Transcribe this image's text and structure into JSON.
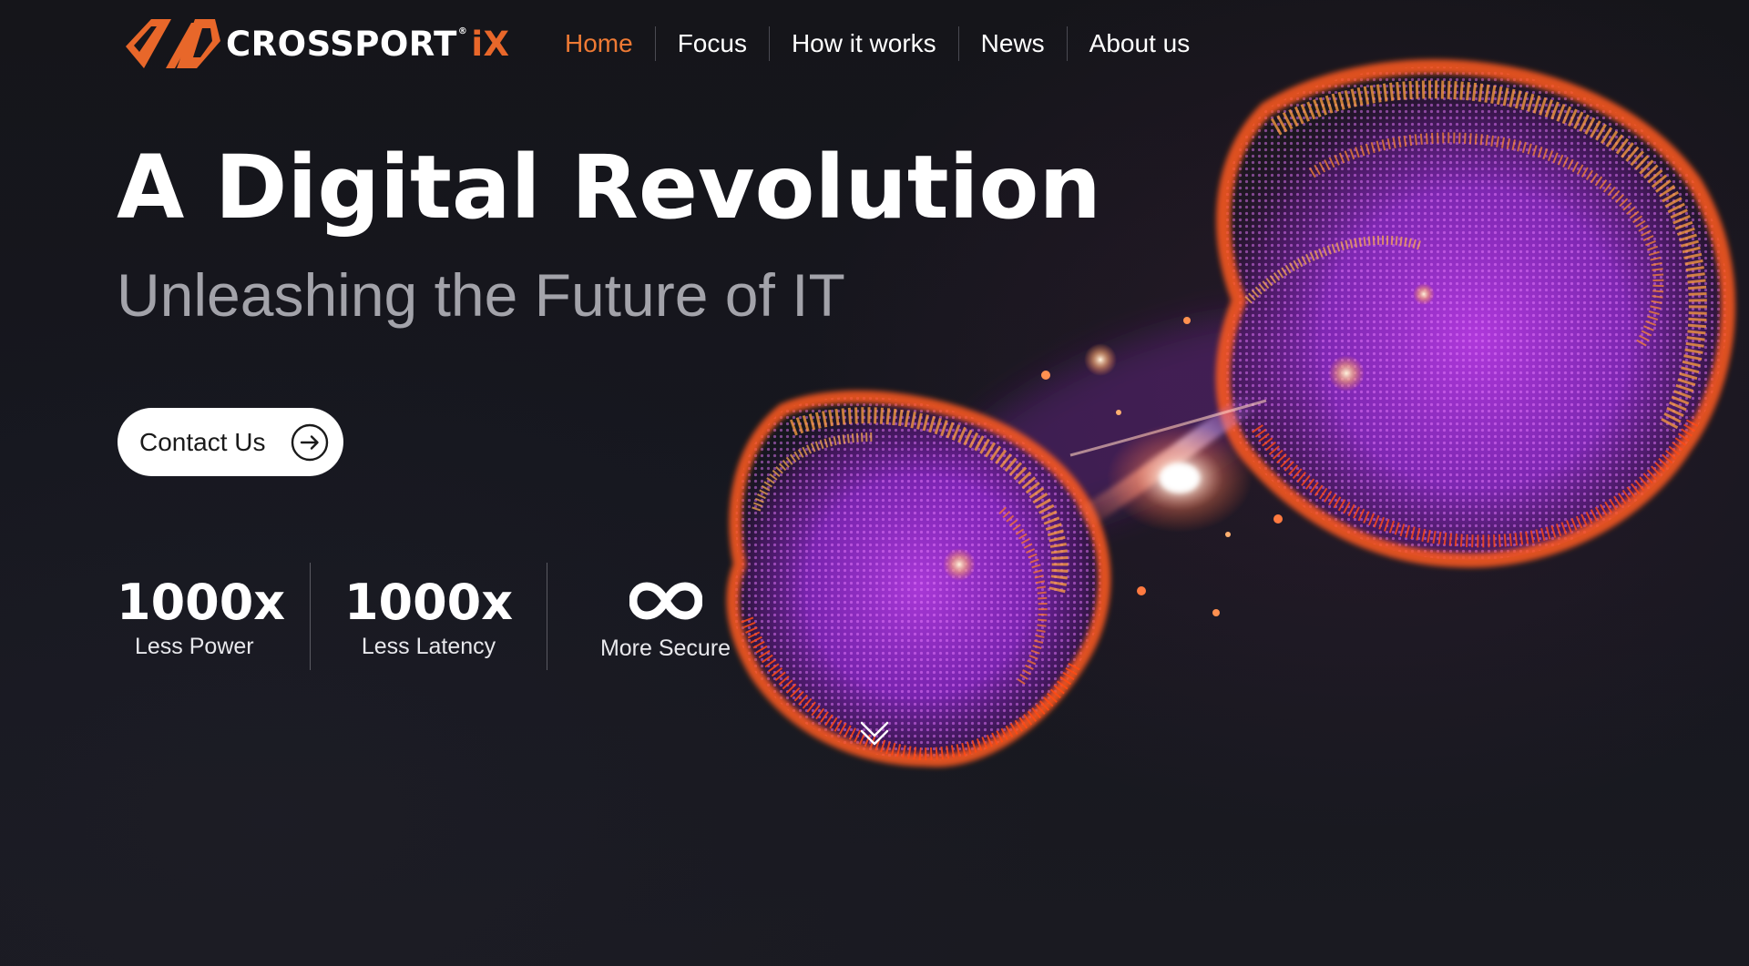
{
  "brand": {
    "name": "CROSSPORT",
    "suffix": "iX",
    "registered_mark": "®",
    "accent_color": "#e8672a"
  },
  "nav": {
    "items": [
      {
        "label": "Home",
        "active": true
      },
      {
        "label": "Focus",
        "active": false
      },
      {
        "label": "How it works",
        "active": false
      },
      {
        "label": "News",
        "active": false
      },
      {
        "label": "About us",
        "active": false
      }
    ],
    "active_color": "#ee7a34"
  },
  "hero": {
    "title": "A Digital Revolution",
    "subtitle": "Unleashing the Future of IT",
    "cta_label": "Contact Us",
    "cta_icon": "arrow-right-circle-icon"
  },
  "stats": [
    {
      "value": "1000x",
      "label": "Less Power"
    },
    {
      "value": "1000x",
      "label": "Less Latency"
    },
    {
      "icon": "infinity-icon",
      "label": "More Secure"
    }
  ],
  "scroll_indicator": {
    "icon": "double-chevron-down-icon"
  },
  "background_art": {
    "icon": "glowing-particle-spheres",
    "colors": [
      "#ff6a1a",
      "#ffa040",
      "#a22cd8",
      "#6e1fb0"
    ]
  }
}
